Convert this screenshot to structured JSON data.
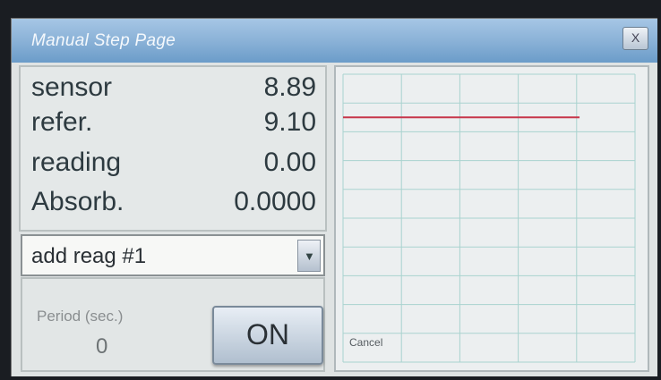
{
  "window": {
    "title": "Manual Step Page",
    "close_label": "X"
  },
  "readout": [
    {
      "label": "sensor",
      "value": "8.89"
    },
    {
      "label": "refer.",
      "value": "9.10"
    },
    {
      "label": "reading",
      "value": "0.00"
    },
    {
      "label": "Absorb.",
      "value": "0.0000"
    }
  ],
  "step_select": {
    "selected": "add reag #1"
  },
  "period": {
    "label": "Period (sec.)",
    "value": "0"
  },
  "toggle": {
    "label": "ON"
  },
  "graph": {
    "cancel_label": "Cancel",
    "grid_color": "#a9d3cf",
    "trace_color": "#c7364a",
    "trace_level": 0.85,
    "trace_extent": 0.81
  }
}
